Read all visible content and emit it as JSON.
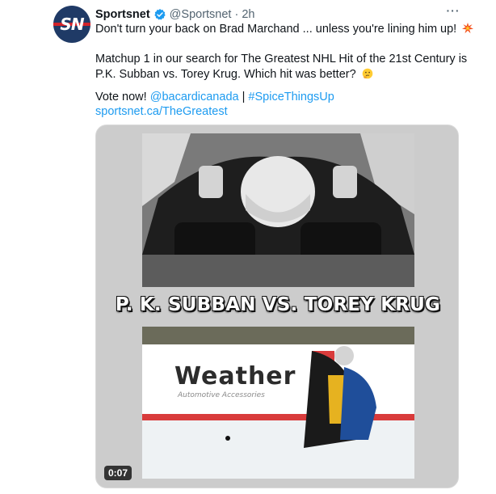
{
  "tweet": {
    "author": {
      "name": "Sportsnet",
      "handle": "@Sportsnet",
      "separator": "·",
      "time": "2h",
      "avatar_text": "SN",
      "verified_color": "#1d9bf0"
    },
    "more_menu": "···",
    "lines": {
      "line1": "Don't turn your back on Brad Marchand ... unless you're lining him up!",
      "line2": "Matchup 1 in our search for The Greatest NHL Hit of the 21st Century is",
      "line3": "P.K. Subban vs. Torey Krug. Which hit was better?",
      "vote_prefix": "Vote now!",
      "mention": "@bacardicanada",
      "pipe": "|",
      "hashtag": "#SpiceThingsUp",
      "url": "sportsnet.ca/TheGreatest"
    },
    "emojis": [
      "collision-emoji",
      "thinking-face-emoji"
    ],
    "media": {
      "headline": "P. K. SUBBAN VS. TOREY KRUG",
      "board_ad": "Weather",
      "board_ad_sub": "Automotive Accessories",
      "duration": "0:07"
    }
  },
  "colors": {
    "link": "#1d9bf0",
    "secondary_text": "#536471",
    "avatar_bg": "#1f3a66",
    "avatar_band": "#d2232a"
  }
}
